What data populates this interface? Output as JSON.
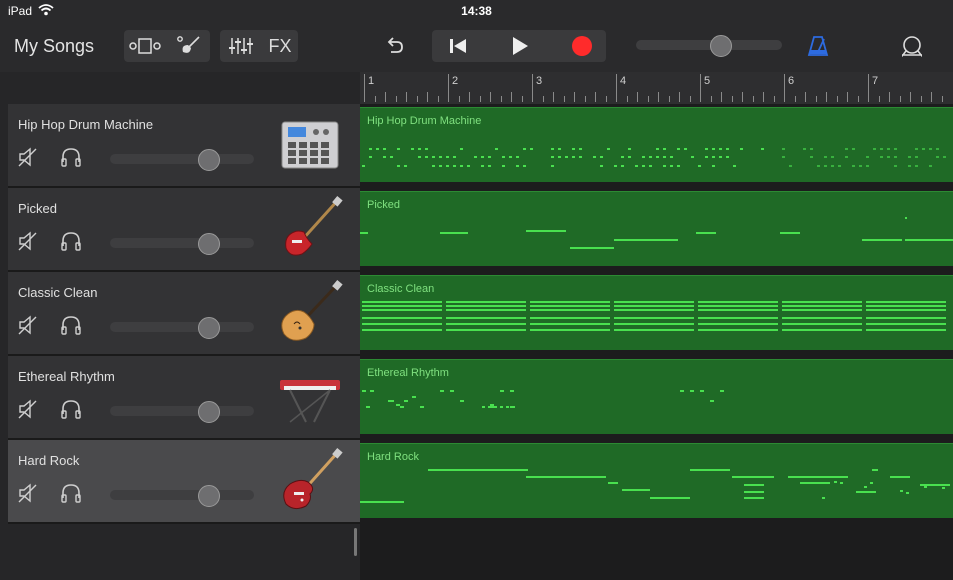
{
  "status": {
    "carrier": "iPad",
    "time": "14:38"
  },
  "toolbar": {
    "my_songs": "My Songs",
    "fx": "FX",
    "master_volume": 0.6
  },
  "ruler": {
    "bars": [
      "1",
      "2",
      "3",
      "4",
      "5",
      "6",
      "7"
    ]
  },
  "tracks": [
    {
      "name": "Hip Hop Drum Machine",
      "volume": 0.68,
      "instrument": "drum-machine-icon",
      "selected": false
    },
    {
      "name": "Picked",
      "volume": 0.68,
      "instrument": "bass-guitar-icon",
      "selected": false
    },
    {
      "name": "Classic Clean",
      "volume": 0.68,
      "instrument": "hollow-body-guitar-icon",
      "selected": false
    },
    {
      "name": "Ethereal Rhythm",
      "volume": 0.68,
      "instrument": "keyboard-icon",
      "selected": false
    },
    {
      "name": "Hard Rock",
      "volume": 0.68,
      "instrument": "electric-guitar-icon",
      "selected": true
    }
  ],
  "colors": {
    "region": "#1f6a26",
    "note": "#49e04f",
    "record": "#ff2b2b",
    "metronome": "#2d6be0"
  }
}
